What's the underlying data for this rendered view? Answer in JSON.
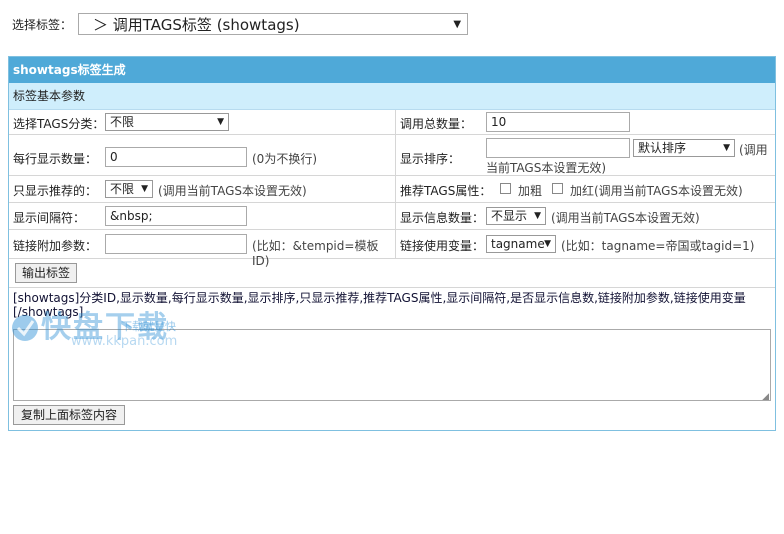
{
  "top": {
    "label": "选择标签：",
    "selected": "＞ 调用TAGS标签 (showtags)"
  },
  "panel": {
    "header": "showtags标签生成",
    "section": "标签基本参数",
    "rows": {
      "r1": {
        "l_label": "选择TAGS分类：",
        "l_select": "不限",
        "r_label": "调用总数量：",
        "r_value": "10"
      },
      "r2": {
        "l_label": "每行显示数量：",
        "l_value": "0",
        "l_note": "(0为不换行)",
        "r_label": "显示排序：",
        "r_value": "",
        "r_select": "默认排序",
        "r_note1": "(调用",
        "r_note2": "当前TAGS本设置无效)"
      },
      "r3": {
        "l_label": "只显示推荐的：",
        "l_select": "不限",
        "l_note": "(调用当前TAGS本设置无效)",
        "r_label": "推荐TAGS属性：",
        "r_bold": "加粗",
        "r_red": "加红(调用当前TAGS本设置无效)"
      },
      "r4": {
        "l_label": "显示间隔符：",
        "l_value": "&nbsp;",
        "r_label": "显示信息数量：",
        "r_select": "不显示",
        "r_note": "(调用当前TAGS本设置无效)"
      },
      "r5": {
        "l_label": "链接附加参数：",
        "l_value": "",
        "l_note": "(比如：&tempid=模板ID)",
        "r_label": "链接使用变量：",
        "r_select": "tagname",
        "r_note": "(比如：tagname=帝国或tagid=1)"
      }
    },
    "output_button": "输出标签",
    "template_line1": "[showtags]分类ID,显示数量,每行显示数量,显示排序,只显示推荐,推荐TAGS属性,显示间隔符,是否显示信息数,链接附加参数,链接使用变量",
    "template_line2": "[/showtags]",
    "copy_button": "复制上面标签内容"
  },
  "watermark": {
    "main": "快盘下载",
    "sub": "下载就是快",
    "url": "www.kkpan.com"
  },
  "colors": {
    "header_bg": "#4fa9d8",
    "section_bg": "#cfeefc",
    "border": "#7fc0e0",
    "watermark": "#2d8fd6"
  }
}
